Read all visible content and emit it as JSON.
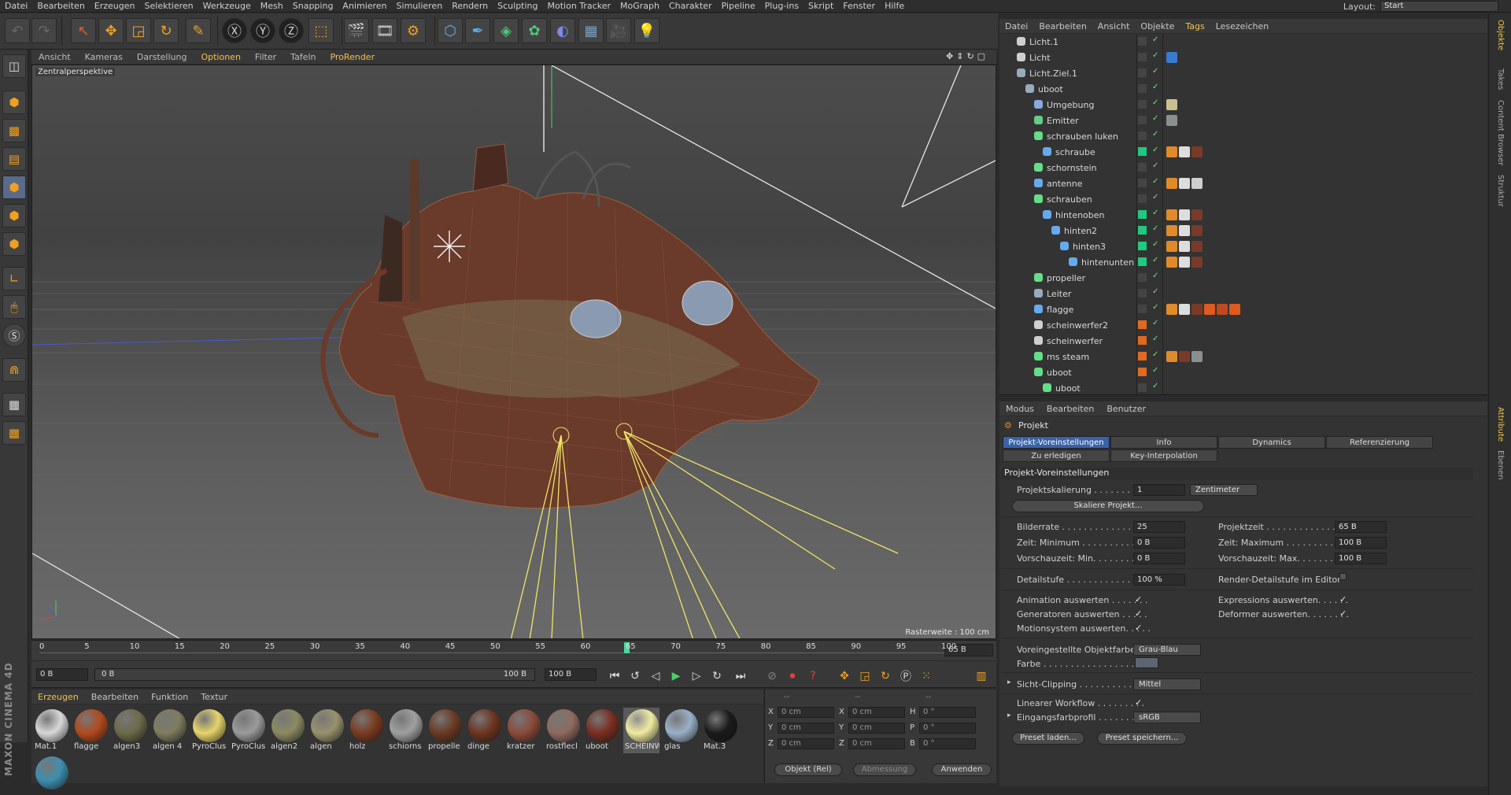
{
  "menu": [
    "Datei",
    "Bearbeiten",
    "Erzeugen",
    "Selektieren",
    "Werkzeuge",
    "Mesh",
    "Snapping",
    "Animieren",
    "Simulieren",
    "Rendern",
    "Sculpting",
    "Motion Tracker",
    "MoGraph",
    "Charakter",
    "Pipeline",
    "Plug-ins",
    "Skript",
    "Fenster",
    "Hilfe"
  ],
  "layout": {
    "label": "Layout:",
    "value": "Start"
  },
  "viewport": {
    "menu": [
      "Ansicht",
      "Kameras",
      "Darstellung",
      "Optionen",
      "Filter",
      "Tafeln",
      "ProRender"
    ],
    "title": "Zentralperspektive",
    "raster": "Rasterweite : 100 cm"
  },
  "timeline": {
    "ticks": [
      "0",
      "5",
      "10",
      "15",
      "20",
      "25",
      "30",
      "35",
      "40",
      "45",
      "50",
      "55",
      "60",
      "65",
      "70",
      "75",
      "80",
      "85",
      "90",
      "95",
      "100"
    ],
    "current": "65 B",
    "current_value": 65,
    "max_value": 100
  },
  "transport": {
    "start": "0 B",
    "range_start": "0 B",
    "range_end": "100 B",
    "end": "100 B"
  },
  "material_manager": {
    "menu": [
      "Erzeugen",
      "Bearbeiten",
      "Funktion",
      "Textur"
    ],
    "materials": [
      {
        "name": "Mat.1",
        "color": "#d8d8d8"
      },
      {
        "name": "flagge",
        "color": "#b24a1e"
      },
      {
        "name": "algen3",
        "color": "#6e6a4a"
      },
      {
        "name": "algen 4",
        "color": "#7f7c5e"
      },
      {
        "name": "PyroClus",
        "color": "#e6d46a"
      },
      {
        "name": "PyroClus",
        "color": "#9a9a9a"
      },
      {
        "name": "algen2",
        "color": "#8c8a62"
      },
      {
        "name": "algen",
        "color": "#98926c"
      },
      {
        "name": "holz",
        "color": "#7a3b20"
      },
      {
        "name": "schiorns",
        "color": "#a0a0a0"
      },
      {
        "name": "propelle",
        "color": "#6b3a22"
      },
      {
        "name": "dinge",
        "color": "#6e3420"
      },
      {
        "name": "kratzer",
        "color": "#8a4a3a"
      },
      {
        "name": "rostflecl",
        "color": "#8f6a5e"
      },
      {
        "name": "uboot",
        "color": "#7a2e22"
      },
      {
        "name": "SCHEINW",
        "color": "#f0eba0"
      },
      {
        "name": "glas",
        "color": "#9ab0c8"
      },
      {
        "name": "Mat.3",
        "color": "#1a1a1a"
      },
      {
        "name": "",
        "color": "#3d8fb0"
      }
    ]
  },
  "coordinates": {
    "headers": [
      "--",
      "--",
      "--"
    ],
    "rows": [
      {
        "a": "X",
        "av": "0 cm",
        "b": "X",
        "bv": "0 cm",
        "c": "H",
        "cv": "0 °"
      },
      {
        "a": "Y",
        "av": "0 cm",
        "b": "Y",
        "bv": "0 cm",
        "c": "P",
        "cv": "0 °"
      },
      {
        "a": "Z",
        "av": "0 cm",
        "b": "Z",
        "bv": "0 cm",
        "c": "B",
        "cv": "0 °"
      }
    ],
    "mode": "Objekt (Rel)",
    "size_mode": "Abmessung",
    "apply": "Anwenden"
  },
  "object_manager": {
    "menu": [
      "Datei",
      "Bearbeiten",
      "Ansicht",
      "Objekte",
      "Tags",
      "Lesezeichen"
    ],
    "objects": [
      {
        "name": "Licht.1",
        "indent": 0,
        "icon": "#cfcfcf",
        "color": "",
        "tags": []
      },
      {
        "name": "Licht",
        "indent": 0,
        "icon": "#cfcfcf",
        "color": "",
        "tags": [
          "#3a7ad0"
        ]
      },
      {
        "name": "Licht.Ziel.1",
        "indent": 0,
        "icon": "#9ab",
        "color": "",
        "tags": []
      },
      {
        "name": "uboot",
        "indent": 1,
        "icon": "#9ab",
        "color": "",
        "tags": []
      },
      {
        "name": "Umgebung",
        "indent": 2,
        "icon": "#88aadd",
        "color": "",
        "tags": [
          "#c8c090"
        ]
      },
      {
        "name": "Emitter",
        "indent": 2,
        "icon": "#66cc88",
        "color": "",
        "tags": [
          "#8a9090"
        ]
      },
      {
        "name": "schrauben luken",
        "indent": 2,
        "icon": "#66dd88",
        "color": "",
        "tags": []
      },
      {
        "name": "schraube",
        "indent": 3,
        "icon": "#66aaee",
        "color": "#1fc97d",
        "tags": [
          "#e08a2a",
          "#ddd",
          "#7a3a28"
        ]
      },
      {
        "name": "schornstein",
        "indent": 2,
        "icon": "#66dd88",
        "color": "",
        "tags": []
      },
      {
        "name": "antenne",
        "indent": 2,
        "icon": "#66aaee",
        "color": "",
        "tags": [
          "#e08a2a",
          "#ddd",
          "#cfcfcf"
        ]
      },
      {
        "name": "schrauben",
        "indent": 2,
        "icon": "#66dd88",
        "color": "",
        "tags": []
      },
      {
        "name": "hintenoben",
        "indent": 3,
        "icon": "#66aaee",
        "color": "#1fc97d",
        "tags": [
          "#e08a2a",
          "#ddd",
          "#7a3a28"
        ]
      },
      {
        "name": "hinten2",
        "indent": 4,
        "icon": "#66aaee",
        "color": "#1fc97d",
        "tags": [
          "#e08a2a",
          "#ddd",
          "#7a3a28"
        ]
      },
      {
        "name": "hinten3",
        "indent": 5,
        "icon": "#66aaee",
        "color": "#1fc97d",
        "tags": [
          "#e08a2a",
          "#ddd",
          "#7a3a28"
        ]
      },
      {
        "name": "hintenunten",
        "indent": 6,
        "icon": "#66aaee",
        "color": "#1fc97d",
        "tags": [
          "#e08a2a",
          "#ddd",
          "#7a3a28"
        ]
      },
      {
        "name": "propeller",
        "indent": 2,
        "icon": "#66dd88",
        "color": "",
        "tags": []
      },
      {
        "name": "Leiter",
        "indent": 2,
        "icon": "#9ab",
        "color": "",
        "tags": []
      },
      {
        "name": "flagge",
        "indent": 2,
        "icon": "#66aaee",
        "color": "",
        "tags": [
          "#e08a2a",
          "#ddd",
          "#7a3a28",
          "#e05a20",
          "#c04a20",
          "#e05a20"
        ]
      },
      {
        "name": "scheinwerfer2",
        "indent": 2,
        "icon": "#cfcfcf",
        "color": "#e06a20",
        "tags": []
      },
      {
        "name": "scheinwerfer",
        "indent": 2,
        "icon": "#cfcfcf",
        "color": "#e06a20",
        "tags": []
      },
      {
        "name": "ms steam",
        "indent": 2,
        "icon": "#66dd88",
        "color": "#e06a20",
        "tags": [
          "#e08a2a",
          "#7a3a28",
          "#8a9090"
        ]
      },
      {
        "name": "uboot",
        "indent": 2,
        "icon": "#66dd88",
        "color": "#e06a20",
        "tags": []
      },
      {
        "name": "uboot",
        "indent": 3,
        "icon": "#66dd88",
        "color": "",
        "tags": []
      }
    ]
  },
  "attribute_manager": {
    "menu": [
      "Modus",
      "Bearbeiten",
      "Benutzer"
    ],
    "title": "Projekt",
    "tabs": [
      "Projekt-Voreinstellungen",
      "Info",
      "Dynamics",
      "Referenzierung",
      "Zu erledigen",
      "Key-Interpolation"
    ],
    "section": "Projekt-Voreinstellungen",
    "scale_label": "Projektskalierung . . . . . . . . .",
    "scale_value": "1",
    "scale_unit": "Zentimeter",
    "scale_btn": "Skaliere Projekt...",
    "fps_label": "Bilderrate . . . . . . . . . . . . . . . .",
    "fps_value": "25",
    "projtime_label": "Projektzeit . . . . . . . . . . . . . .",
    "projtime_value": "65 B",
    "tmin_label": "Zeit: Minimum . . . . . . . . . . .",
    "tmin_value": "0 B",
    "tmax_label": "Zeit: Maximum . . . . . . . . . .",
    "tmax_value": "100 B",
    "pmin_label": "Vorschauzeit: Min. . . . . . . . .",
    "pmin_value": "0 B",
    "pmax_label": "Vorschauzeit: Max. . . . . . . . .",
    "pmax_value": "100 B",
    "lod_label": "Detailstufe . . . . . . . . . . . . . . .",
    "lod_value": "100 %",
    "rlod_label": "Render-Detailstufe im Editor",
    "anim_label": "Animation auswerten . . . . . . .",
    "expr_label": "Expressions auswerten. . . . . .",
    "gen_label": "Generatoren auswerten . . . . .",
    "def_label": "Deformer auswerten. . . . . . . .",
    "mot_label": "Motionsystem auswerten. . . . .",
    "objcolor_label": "Voreingestellte Objektfarbe",
    "objcolor_value": "Grau-Blau",
    "color_label": "Farbe . . . . . . . . . . . . . . . . . . . .",
    "clip_label": "Sicht-Clipping . . . . . . . . . . . .",
    "clip_value": "Mittel",
    "linear_label": "Linearer Workflow . . . . . . . . .",
    "profile_label": "Eingangsfarbprofil . . . . . . . . .",
    "profile_value": "sRGB",
    "preset_load": "Preset laden...",
    "preset_save": "Preset speichern..."
  },
  "right_tabs": [
    "Objekte",
    "Takes",
    "Content Browser",
    "Struktur",
    "Attribute",
    "Ebenen"
  ],
  "checkmark": "✓",
  "brand": "MAXON CINEMA 4D"
}
